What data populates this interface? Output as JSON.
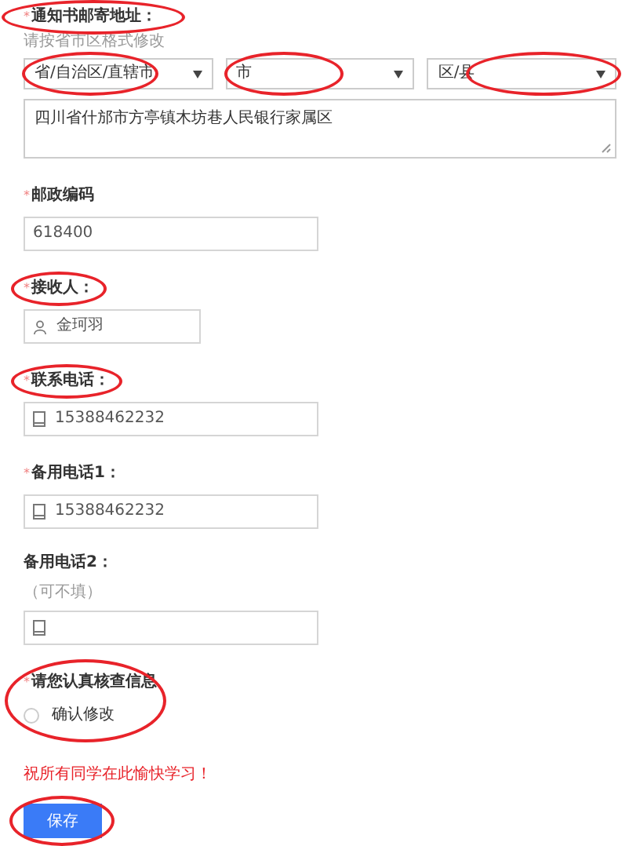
{
  "address": {
    "label": "通知书邮寄地址：",
    "mark": "*",
    "circled": true,
    "hint": "请按省市区格式修改",
    "selects": [
      {
        "value": "省/自治区/直辖市",
        "circled": true
      },
      {
        "value": "市",
        "circled": true
      },
      {
        "value": "区/县",
        "circled": true
      }
    ],
    "detail": "四川省什邡市方亭镇木坊巷人民银行家属区"
  },
  "fields": [
    {
      "label": "邮政编码",
      "mark": "*",
      "circled": false,
      "value": "618400",
      "kind": "plain"
    },
    {
      "label": "接收人：",
      "mark": "*",
      "circled": true,
      "value": "金珂羽",
      "kind": "person"
    },
    {
      "label": "联系电话：",
      "mark": "*",
      "circled": true,
      "value": "15388462232",
      "kind": "phone"
    },
    {
      "label": "备用电话1：",
      "mark": "*",
      "circled": false,
      "value": "15388462232",
      "kind": "phone"
    },
    {
      "label": "备用电话2：",
      "circled": false,
      "note": "（可不填）",
      "kind": "phone"
    }
  ],
  "confirm": {
    "label": "请您认真核查信息",
    "mark": "*",
    "circled": true,
    "option": "确认修改",
    "checked": false
  },
  "notice": "祝所有同学在此愉快学习！",
  "save_button": {
    "label": "保存",
    "circled": true
  }
}
